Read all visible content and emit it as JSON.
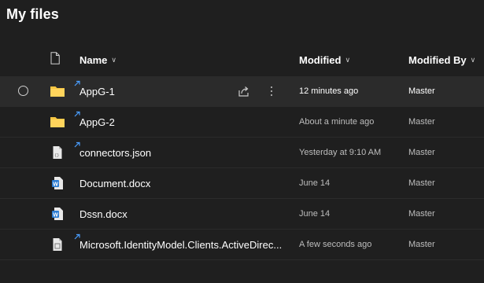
{
  "page_title": "My files",
  "columns": {
    "name": "Name",
    "modified": "Modified",
    "modified_by": "Modified By"
  },
  "files": [
    {
      "name": "AppG-1",
      "type": "folder",
      "modified": "12 minutes ago",
      "modified_by": "Master",
      "selected_hover": true
    },
    {
      "name": "AppG-2",
      "type": "folder",
      "modified": "About a minute ago",
      "modified_by": "Master"
    },
    {
      "name": "connectors.json",
      "type": "json",
      "modified": "Yesterday at 9:10 AM",
      "modified_by": "Master"
    },
    {
      "name": "Document.docx",
      "type": "word",
      "modified": "June 14",
      "modified_by": "Master"
    },
    {
      "name": "Dssn.docx",
      "type": "word",
      "modified": "June 14",
      "modified_by": "Master"
    },
    {
      "name": "Microsoft.IdentityModel.Clients.ActiveDirec...",
      "type": "file",
      "modified": "A few seconds ago",
      "modified_by": "Master"
    }
  ],
  "colors": {
    "background": "#1f1f1f",
    "folder": "#f5c542",
    "word": "#2b7cd3",
    "new_mark": "#4a9eff"
  }
}
